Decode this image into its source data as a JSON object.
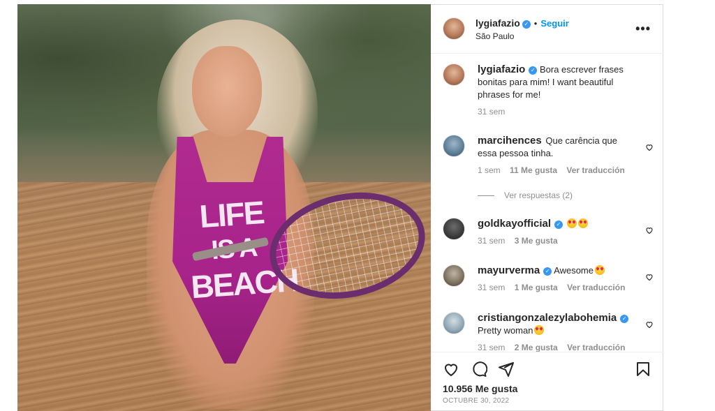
{
  "post": {
    "author": "lygiafazio",
    "location": "São Paulo",
    "follow_label": "Seguir",
    "more_icon": "more-horizontal-icon",
    "image_text_line1": "LIFE",
    "image_text_line2": "IS A",
    "image_text_line3": "BEACH"
  },
  "caption": {
    "user": "lygiafazio",
    "text": "Bora escrever frases bonitas para mim! I want beautiful phrases for me!",
    "time": "31 sem"
  },
  "comments": [
    {
      "user": "marcihences",
      "verified": false,
      "text": "Que carência que essa pessoa tinha.",
      "time": "1 sem",
      "likes": "11 Me gusta",
      "translate": "Ver traducción",
      "replies": "Ver respuestas (2)"
    },
    {
      "user": "goldkayofficial",
      "verified": true,
      "text": "",
      "time": "31 sem",
      "likes": "3 Me gusta",
      "translate": ""
    },
    {
      "user": "mayurverma",
      "verified": true,
      "text": "Awesome",
      "time": "31 sem",
      "likes": "1 Me gusta",
      "translate": "Ver traducción"
    },
    {
      "user": "cristiangonzalezylabohemia",
      "verified": true,
      "text": "Pretty woman",
      "time": "31 sem",
      "likes": "2 Me gusta",
      "translate": "Ver traducción"
    }
  ],
  "footer": {
    "likes": "10.956 Me gusta",
    "date": "OCTUBRE 30, 2022"
  },
  "colors": {
    "link_blue": "#0095f6",
    "verified_blue": "#3897f0",
    "text_primary": "#262626",
    "text_secondary": "#8e8e8e"
  }
}
